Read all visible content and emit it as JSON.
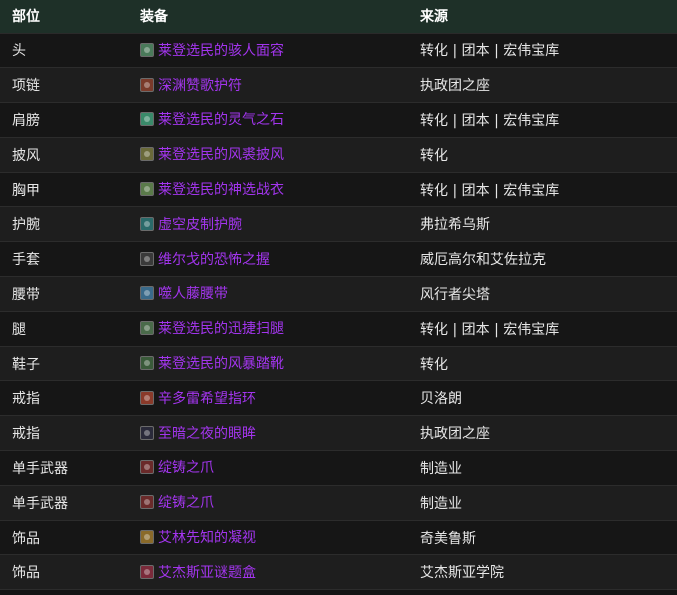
{
  "headers": {
    "slot": "部位",
    "item": "装备",
    "source": "来源"
  },
  "rows": [
    {
      "slot": "头",
      "item": "莱登选民的骇人面容",
      "source": "转化 | 团本 | 宏伟宝库",
      "icon": "helmet-icon",
      "icon_color": "#4a7a5a"
    },
    {
      "slot": "项链",
      "item": "深渊赞歌护符",
      "source": "执政团之座",
      "icon": "necklace-icon",
      "icon_color": "#7a3a2a"
    },
    {
      "slot": "肩膀",
      "item": "莱登选民的灵气之石",
      "source": "转化 | 团本 | 宏伟宝库",
      "icon": "shoulder-icon",
      "icon_color": "#3a8a6a"
    },
    {
      "slot": "披风",
      "item": "莱登选民的风裘披风",
      "source": "转化",
      "icon": "cloak-icon",
      "icon_color": "#6a6a3a"
    },
    {
      "slot": "胸甲",
      "item": "莱登选民的神选战衣",
      "source": "转化 | 团本 | 宏伟宝库",
      "icon": "chest-icon",
      "icon_color": "#5a7a4a"
    },
    {
      "slot": "护腕",
      "item": "虚空皮制护腕",
      "source": "弗拉希乌斯",
      "icon": "bracer-icon",
      "icon_color": "#2a6a6a"
    },
    {
      "slot": "手套",
      "item": "维尔戈的恐怖之握",
      "source": "威厄高尔和艾佐拉克",
      "icon": "gloves-icon",
      "icon_color": "#3a3a3a"
    },
    {
      "slot": "腰带",
      "item": "噬人藤腰带",
      "source": "风行者尖塔",
      "icon": "belt-icon",
      "icon_color": "#3a6a8a"
    },
    {
      "slot": "腿",
      "item": "莱登选民的迅捷扫腿",
      "source": "转化 | 团本 | 宏伟宝库",
      "icon": "legs-icon",
      "icon_color": "#4a6a4a"
    },
    {
      "slot": "鞋子",
      "item": "莱登选民的风暴踏靴",
      "source": "转化",
      "icon": "boots-icon",
      "icon_color": "#3a5a3a"
    },
    {
      "slot": "戒指",
      "item": "辛多雷希望指环",
      "source": "贝洛朗",
      "icon": "ring-icon",
      "icon_color": "#8a3a2a"
    },
    {
      "slot": "戒指",
      "item": "至暗之夜的眼眸",
      "source": "执政团之座",
      "icon": "ring-icon",
      "icon_color": "#2a2a3a"
    },
    {
      "slot": "单手武器",
      "item": "绽铸之爪",
      "source": "制造业",
      "icon": "claw-icon",
      "icon_color": "#6a2a2a"
    },
    {
      "slot": "单手武器",
      "item": "绽铸之爪",
      "source": "制造业",
      "icon": "claw-icon",
      "icon_color": "#6a2a2a"
    },
    {
      "slot": "饰品",
      "item": "艾林先知的凝视",
      "source": "奇美鲁斯",
      "icon": "trinket-icon",
      "icon_color": "#8a6a2a"
    },
    {
      "slot": "饰品",
      "item": "艾杰斯亚谜题盒",
      "source": "艾杰斯亚学院",
      "icon": "box-icon",
      "icon_color": "#7a2a3a"
    }
  ]
}
